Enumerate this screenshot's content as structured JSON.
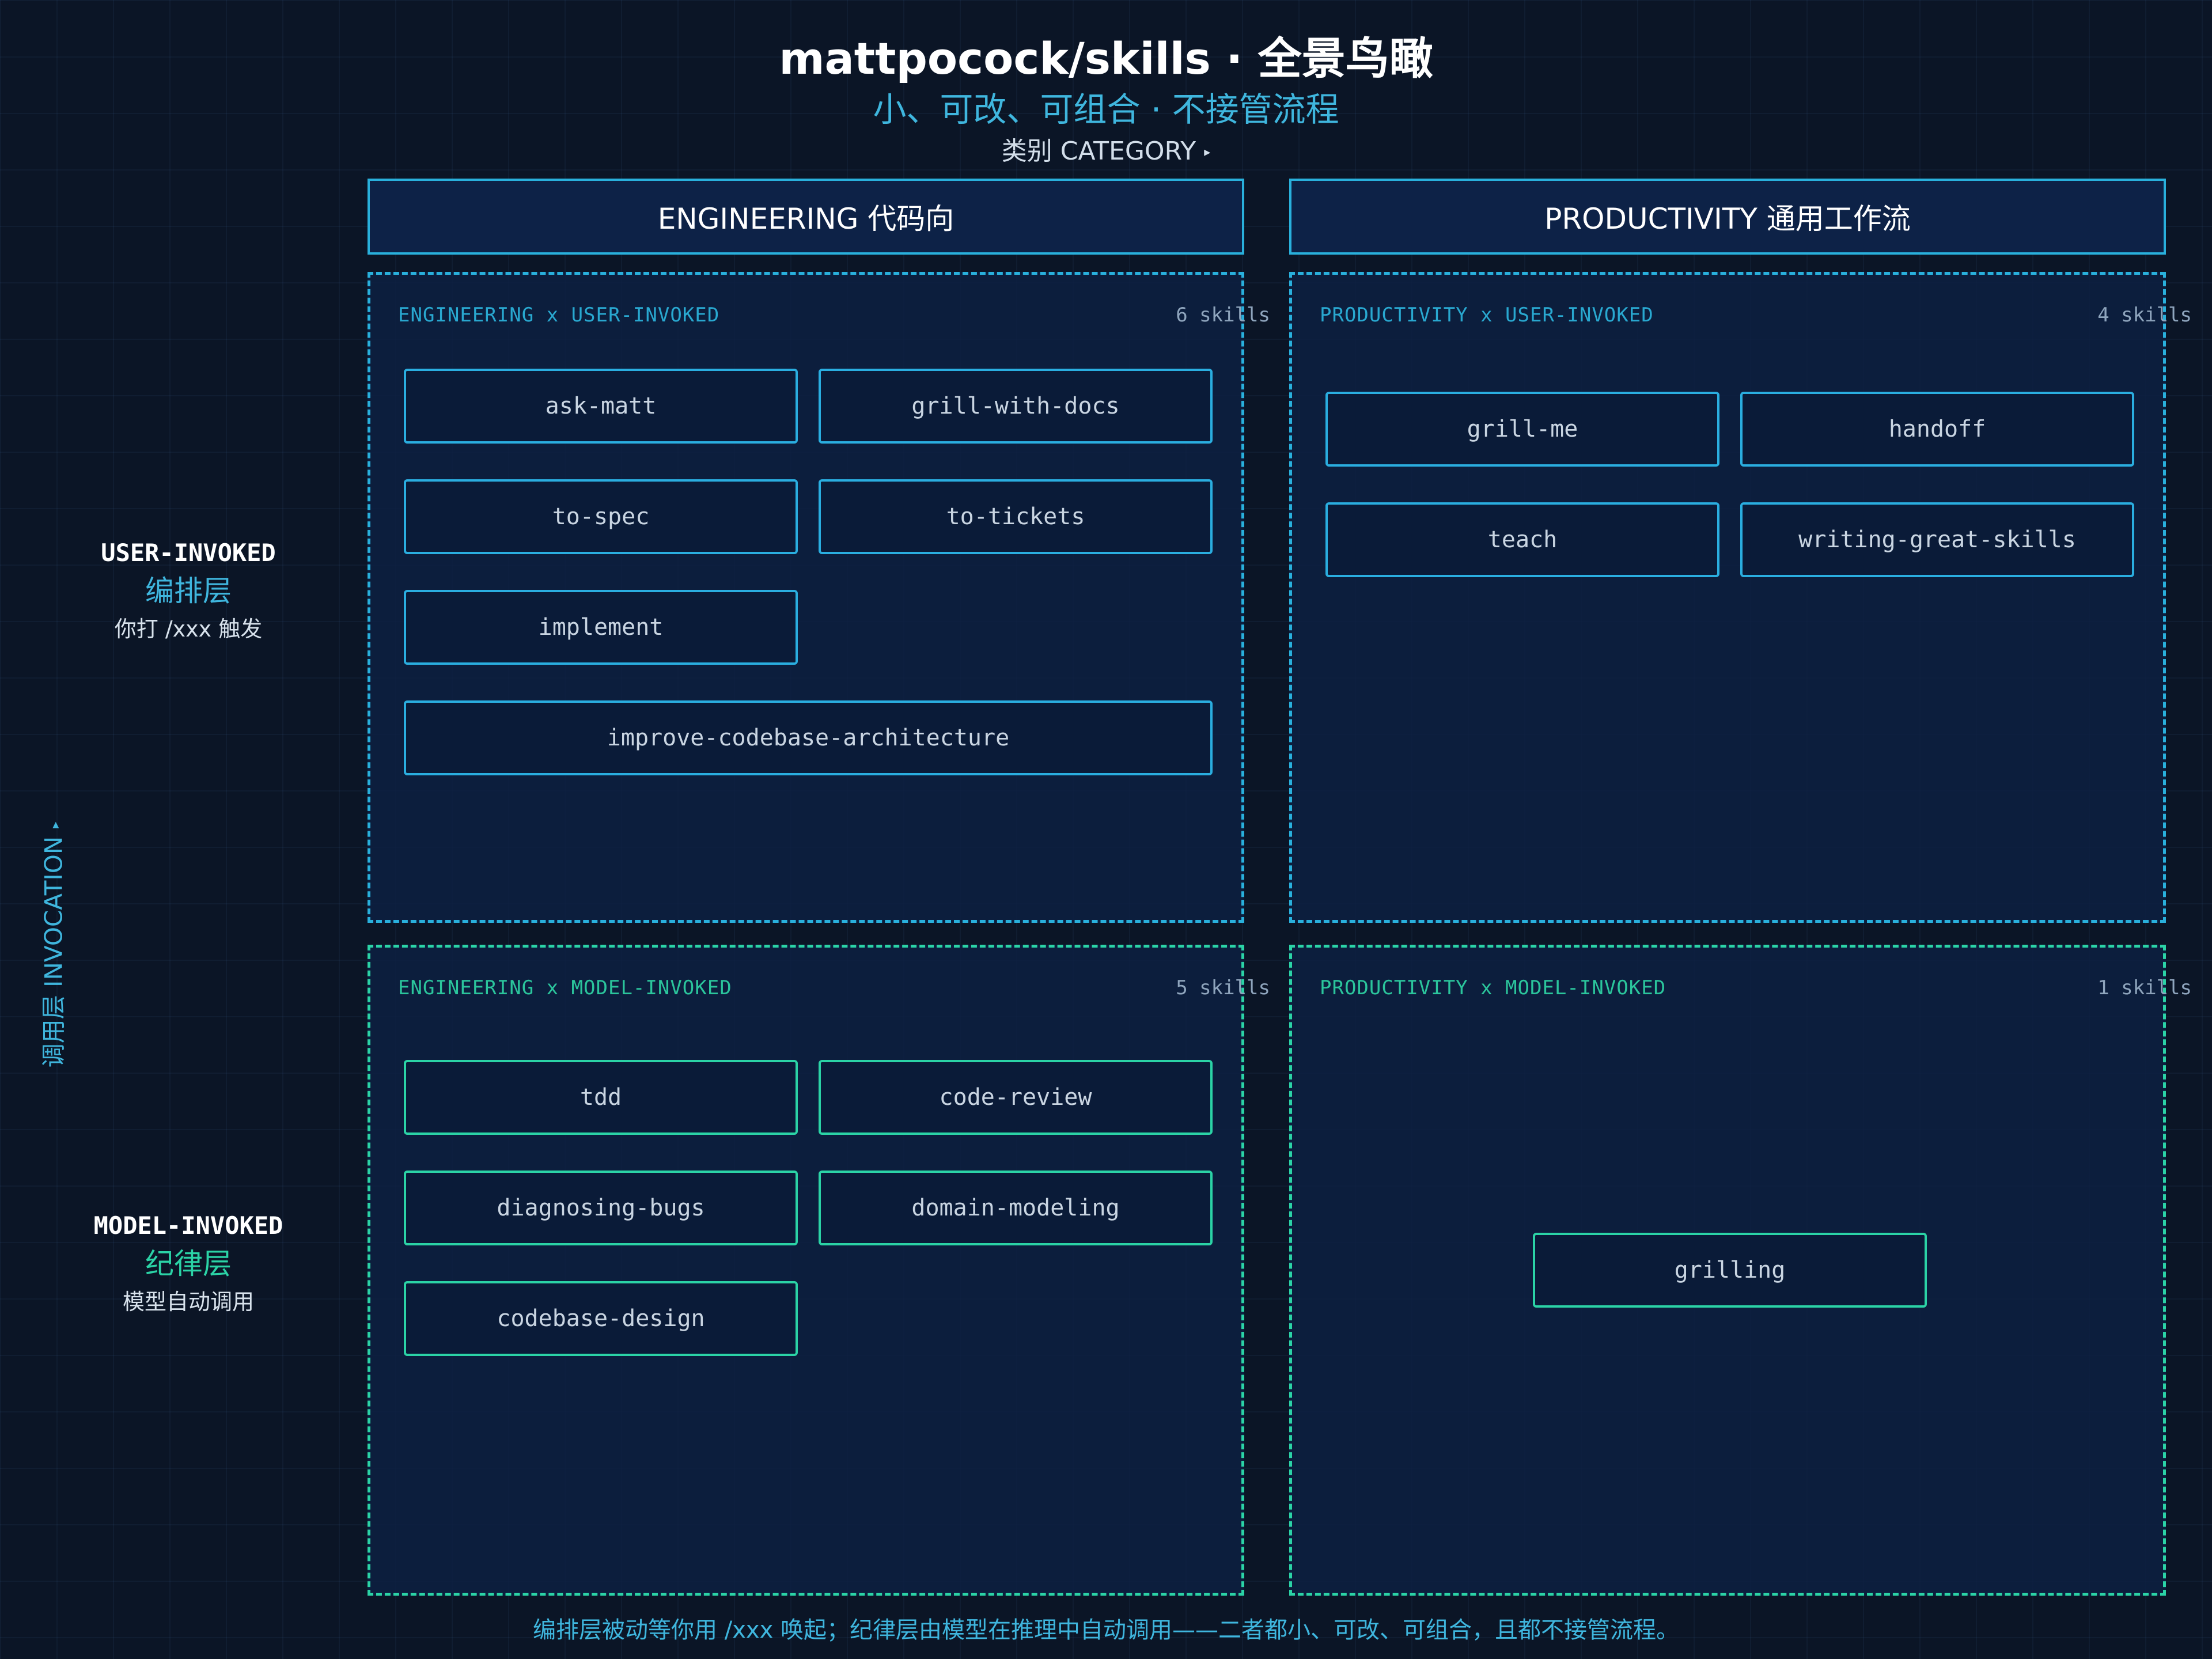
{
  "header": {
    "title": "mattpocock/skills · 全景鸟瞰",
    "subtitle": "小、可改、可组合 · 不接管流程",
    "category_axis": "类别 CATEGORY",
    "category_marker": "▸"
  },
  "columns": [
    {
      "label": "ENGINEERING 代码向"
    },
    {
      "label": "PRODUCTIVITY 通用工作流"
    }
  ],
  "rows": [
    {
      "en": "USER-INVOKED",
      "zh": "编排层",
      "desc": "你打 /xxx 触发",
      "color": "#3fb6de"
    },
    {
      "en": "MODEL-INVOKED",
      "zh": "纪律层",
      "desc": "模型自动调用",
      "color": "#2bd3a6"
    }
  ],
  "invocation_axis": "调用层 INVOCATION",
  "invocation_marker": "▸",
  "quadrants": {
    "eng_user": {
      "label": "ENGINEERING x USER-INVOKED",
      "count": "6 skills",
      "skills": [
        "ask-matt",
        "grill-with-docs",
        "to-spec",
        "to-tickets",
        "implement",
        "improve-codebase-architecture"
      ]
    },
    "prod_user": {
      "label": "PRODUCTIVITY x USER-INVOKED",
      "count": "4 skills",
      "skills": [
        "grill-me",
        "handoff",
        "teach",
        "writing-great-skills"
      ]
    },
    "eng_model": {
      "label": "ENGINEERING x MODEL-INVOKED",
      "count": "5 skills",
      "skills": [
        "tdd",
        "code-review",
        "diagnosing-bugs",
        "domain-modeling",
        "codebase-design"
      ]
    },
    "prod_model": {
      "label": "PRODUCTIVITY x MODEL-INVOKED",
      "count": "1 skills",
      "skills": [
        "grilling"
      ]
    }
  },
  "footer": "编排层被动等你用 /xxx 唤起；纪律层由模型在推理中自动调用——二者都小、可改、可组合，且都不接管流程。",
  "colors": {
    "user_accent": "#29b0dc",
    "model_accent": "#2bd3a6",
    "background": "#0b1526"
  }
}
